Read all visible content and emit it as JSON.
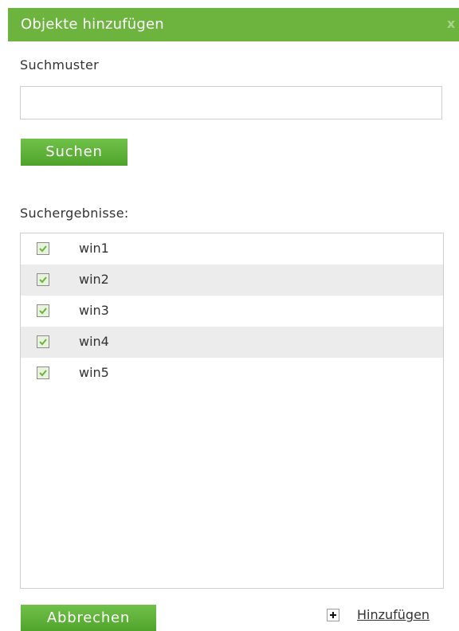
{
  "dialog": {
    "title": "Objekte hinzufügen",
    "close_label": "x"
  },
  "search": {
    "label": "Suchmuster",
    "value": "",
    "placeholder": "",
    "button_label": "Suchen"
  },
  "results": {
    "label": "Suchergebnisse:",
    "items": [
      {
        "label": "win1",
        "checked": true
      },
      {
        "label": "win2",
        "checked": true
      },
      {
        "label": "win3",
        "checked": true
      },
      {
        "label": "win4",
        "checked": true
      },
      {
        "label": "win5",
        "checked": true
      }
    ]
  },
  "footer": {
    "cancel_label": "Abbrechen",
    "add_label": "Hinzufügen"
  },
  "colors": {
    "accent": "#6cb43e",
    "button_top": "#71c14a",
    "button_bottom": "#4fa32a",
    "row_alt": "#ececec"
  }
}
